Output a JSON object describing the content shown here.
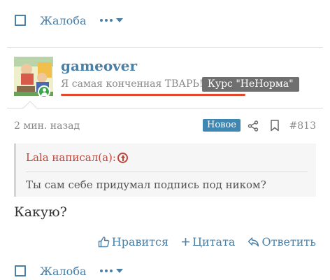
{
  "top_actions": {
    "report_label": "Жалоба"
  },
  "post": {
    "username": "gameover",
    "signature": "Я самая конченная ТВАРЬ!!!",
    "tooltip": "Курс \"НеНорма\"",
    "time": "2 мин. назад",
    "badge": "Новое",
    "post_number": "#813",
    "quote": {
      "author": "Lala написал(а):",
      "text": "Ты сам себе придумал подпись под ником?"
    },
    "body": "Какую?",
    "reactions": {
      "like": "Нравится",
      "quote": "Цитата",
      "reply": "Ответить"
    }
  },
  "bottom_actions": {
    "report_label": "Жалоба"
  },
  "colors": {
    "link": "#4a7fa6",
    "badge": "#3f86b2",
    "quote_author": "#c0453a",
    "underline": "#e2482a",
    "online": "#3aa64a"
  }
}
